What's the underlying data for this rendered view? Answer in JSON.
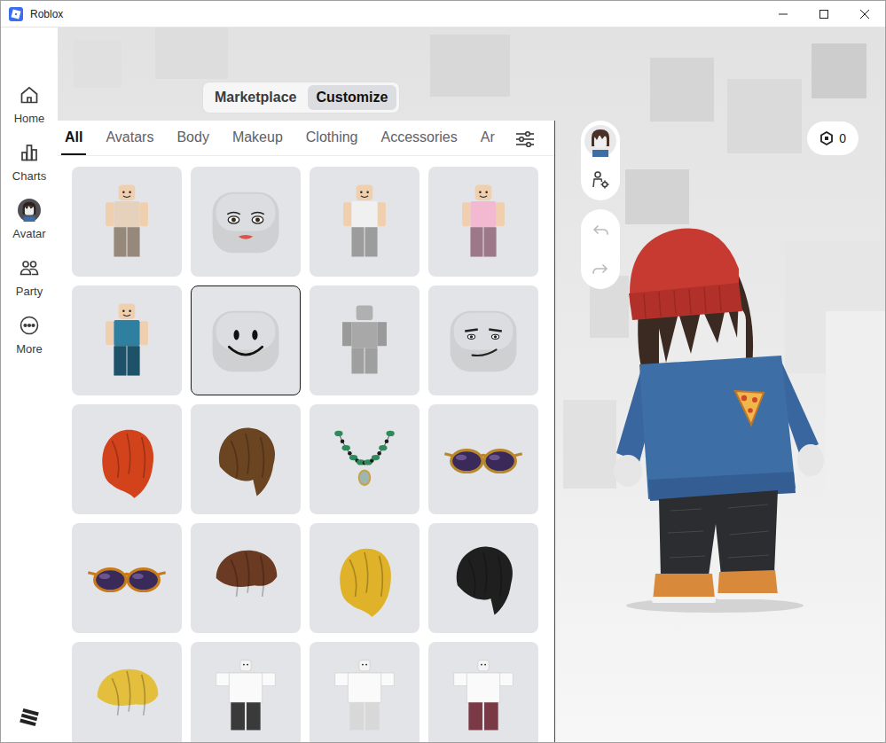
{
  "window": {
    "title": "Roblox"
  },
  "sidebar": {
    "items": [
      {
        "label": "Home"
      },
      {
        "label": "Charts"
      },
      {
        "label": "Avatar"
      },
      {
        "label": "Party"
      },
      {
        "label": "More"
      }
    ]
  },
  "mode_tabs": [
    {
      "label": "Marketplace",
      "selected": false
    },
    {
      "label": "Customize",
      "selected": true
    }
  ],
  "category_tabs": [
    {
      "label": "All",
      "selected": true
    },
    {
      "label": "Avatars",
      "selected": false
    },
    {
      "label": "Body",
      "selected": false
    },
    {
      "label": "Makeup",
      "selected": false
    },
    {
      "label": "Clothing",
      "selected": false
    },
    {
      "label": "Accessories",
      "selected": false
    },
    {
      "label": "Ar",
      "selected": false
    }
  ],
  "items": [
    {
      "kind": "figure",
      "color": "#e6d2bc",
      "selected": false
    },
    {
      "kind": "lady",
      "selected": false
    },
    {
      "kind": "figure",
      "color": "#f0f0f0",
      "selected": false
    },
    {
      "kind": "figure",
      "color": "#f2b9d0",
      "selected": false
    },
    {
      "kind": "figure",
      "color": "#2f7fa0",
      "selected": false
    },
    {
      "kind": "smile",
      "selected": true
    },
    {
      "kind": "block",
      "selected": false
    },
    {
      "kind": "man",
      "selected": false
    },
    {
      "kind": "hair",
      "color": "#d2431c",
      "selected": false
    },
    {
      "kind": "hair",
      "color": "#6b4422",
      "selected": false
    },
    {
      "kind": "necklace",
      "color": "#2f8a5b",
      "selected": false
    },
    {
      "kind": "glasses",
      "color": "#b8862b",
      "selected": false
    },
    {
      "kind": "glasses",
      "color": "#c77a1a",
      "selected": false
    },
    {
      "kind": "hair",
      "color": "#6a3a22",
      "selected": false
    },
    {
      "kind": "hair",
      "color": "#e0b22a",
      "selected": false
    },
    {
      "kind": "hair",
      "color": "#1f1f1f",
      "selected": false
    },
    {
      "kind": "hair",
      "color": "#e3bf3d",
      "selected": false
    },
    {
      "kind": "outfit",
      "color": "#3a3a3a",
      "selected": false
    },
    {
      "kind": "outfit",
      "color": "#d8d8d8",
      "selected": false
    },
    {
      "kind": "outfit",
      "color": "#7a3a45",
      "selected": false
    }
  ],
  "history": {
    "undo": {
      "disabled": true
    },
    "redo": {
      "disabled": true
    }
  },
  "robux": {
    "balance": "0"
  }
}
